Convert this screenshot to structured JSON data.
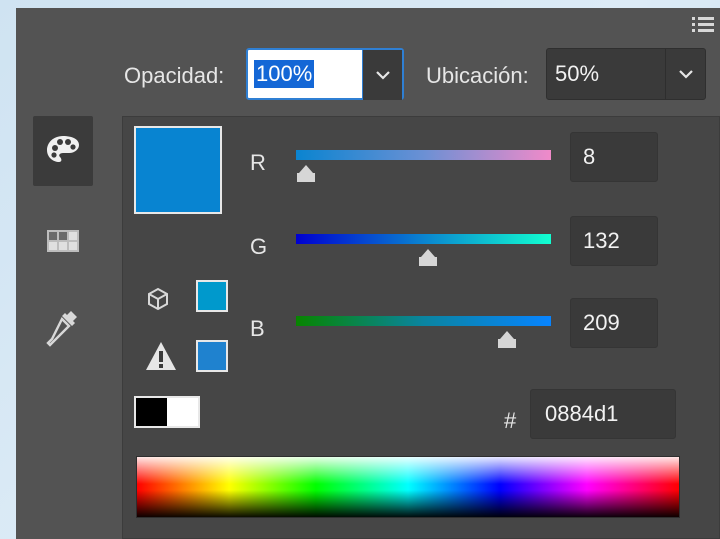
{
  "header": {
    "opacity_label": "Opacidad:",
    "opacity_value": "100%",
    "location_label": "Ubicación:",
    "location_value": "50%"
  },
  "side_tabs": [
    {
      "icon": "palette-icon",
      "active": true
    },
    {
      "icon": "swatches-grid-icon",
      "active": false
    },
    {
      "icon": "eyedropper-icon",
      "active": false
    }
  ],
  "color": {
    "r": "8",
    "g": "132",
    "b": "209",
    "hex_prefix": "#",
    "hex": "0884d1",
    "r_label": "R",
    "g_label": "G",
    "b_label": "B",
    "current": "#0884d1",
    "web_safe": "#0099cc",
    "gamut_warning": "#1f82cf"
  },
  "colors": {
    "panel": "#535353",
    "accent": "#1467d6"
  }
}
